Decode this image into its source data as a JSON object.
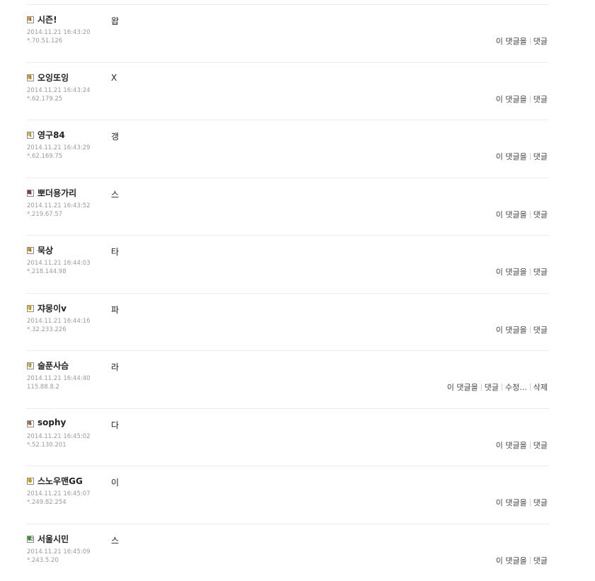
{
  "comments": [
    {
      "badge": "4",
      "badge_color": "#e0a020",
      "nick": "시즌!",
      "date": "2014.11.21 16:43:20",
      "ip": "*.70.51.126",
      "text": "왑",
      "actions": [
        "이 댓글을",
        "댓글"
      ]
    },
    {
      "badge": "3",
      "badge_color": "#e0a020",
      "nick": "오잉또잉",
      "date": "2014.11.21 16:43:24",
      "ip": "*.62.179.25",
      "text": "X",
      "actions": [
        "이 댓글을",
        "댓글"
      ]
    },
    {
      "badge": "1",
      "badge_color": "#f0c000",
      "nick": "영구84",
      "date": "2014.11.21 16:43:29",
      "ip": "*.62.169.75",
      "text": "갱",
      "actions": [
        "이 댓글을",
        "댓글"
      ]
    },
    {
      "badge": "8",
      "badge_color": "#c02020",
      "nick": "뽀더용가리",
      "date": "2014.11.21 16:43:52",
      "ip": "*.219.67.57",
      "text": "스",
      "actions": [
        "이 댓글을",
        "댓글"
      ]
    },
    {
      "badge": "4",
      "badge_color": "#e0a020",
      "nick": "묵상",
      "date": "2014.11.21 16:44:03",
      "ip": "*.218.144.98",
      "text": "타",
      "actions": [
        "이 댓글을",
        "댓글"
      ]
    },
    {
      "badge": "2",
      "badge_color": "#f0c000",
      "nick": "쟈몽이v",
      "date": "2014.11.21 16:44:16",
      "ip": "*.32.233.226",
      "text": "파",
      "actions": [
        "이 댓글을",
        "댓글"
      ]
    },
    {
      "badge": "2",
      "badge_color": "#f0c000",
      "nick": "술푼사슴",
      "date": "2014.11.21 16:44:40",
      "ip": "115.88.8.2",
      "text": "라",
      "actions": [
        "이 댓글을",
        "댓글",
        "수정...",
        "삭제"
      ]
    },
    {
      "badge": "5",
      "badge_color": "#d07020",
      "nick": "sophy",
      "date": "2014.11.21 16:45:02",
      "ip": "*.52.130.201",
      "text": "다",
      "actions": [
        "이 댓글을",
        "댓글"
      ]
    },
    {
      "badge": "0",
      "badge_color": "#f0c000",
      "nick": "스노우맨GG",
      "date": "2014.11.21 16:45:07",
      "ip": "*.249.82.254",
      "text": "이",
      "actions": [
        "이 댓글을",
        "댓글"
      ]
    },
    {
      "badge": "12",
      "badge_color": "#40a040",
      "nick": "서울시민",
      "date": "2014.11.21 16:45:09",
      "ip": "*.243.5.20",
      "text": "스",
      "actions": [
        "이 댓글을",
        "댓글"
      ]
    }
  ]
}
